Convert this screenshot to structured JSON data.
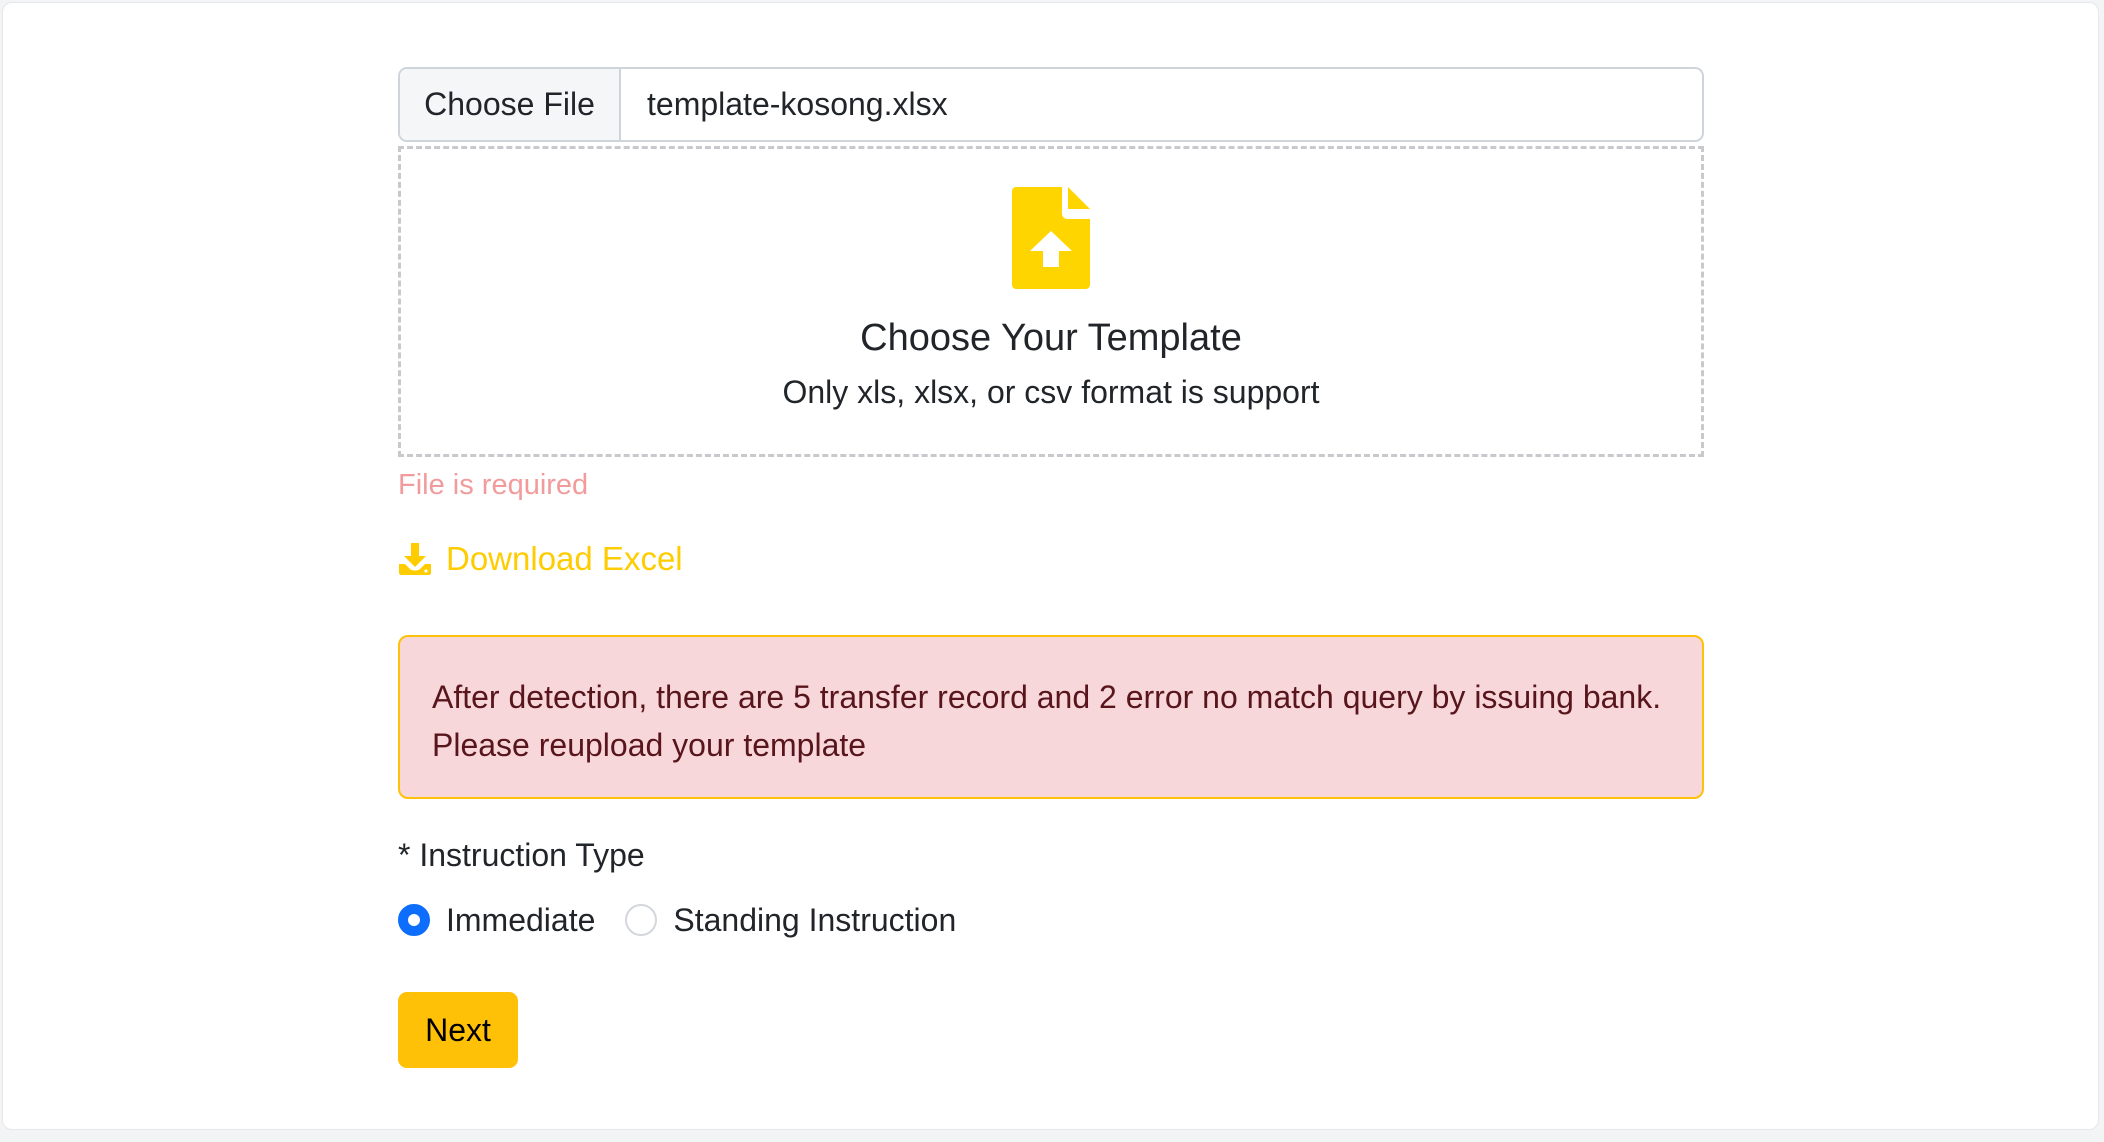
{
  "file_input": {
    "button_label": "Choose File",
    "file_name": "template-kosong.xlsx"
  },
  "dropzone": {
    "icon": "file-upload-icon",
    "title": "Choose Your Template",
    "subtitle": "Only xls, xlsx, or csv format is support"
  },
  "validation": {
    "file_error": "File is required"
  },
  "download": {
    "icon": "download-icon",
    "label": "Download Excel"
  },
  "alert": {
    "message": "After detection, there are 5 transfer record and 2 error no match query by issuing bank. Please reupload your template"
  },
  "instruction_type": {
    "label": "* Instruction Type",
    "options": [
      {
        "label": "Immediate",
        "selected": true
      },
      {
        "label": "Standing Instruction",
        "selected": false
      }
    ]
  },
  "actions": {
    "next_label": "Next"
  },
  "colors": {
    "accent": "#ffcc00",
    "primary_button": "#ffc107",
    "radio_selected": "#0d6efd",
    "error_text": "#f29b9d",
    "alert_bg": "#f8d7da",
    "alert_text": "#58151c"
  }
}
